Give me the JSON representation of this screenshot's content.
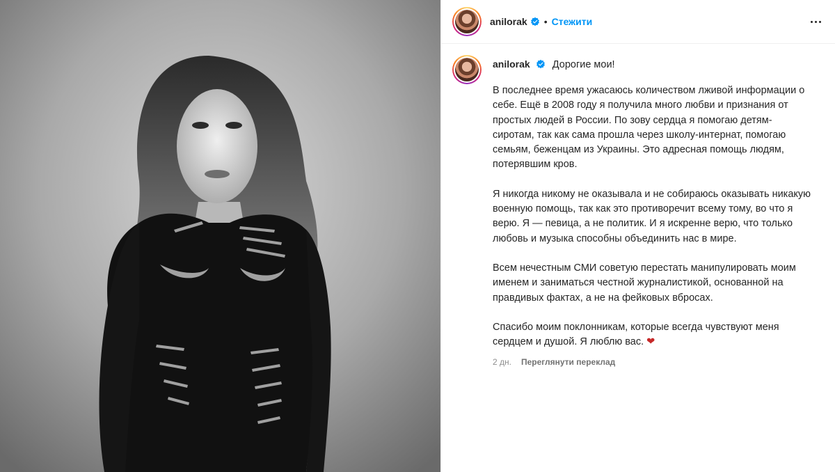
{
  "post": {
    "username": "anilorak",
    "follow_label": "Стежити",
    "separator": "•",
    "greeting": "Дорогие мои!",
    "paragraphs": [
      "В последнее время ужасаюсь количеством лживой информации о себе. Ещё в 2008 году я получила много любви и признания от простых людей в России. По зову сердца я помогаю детям-сиротам, так как сама прошла через школу-интернат, помогаю семьям, беженцам из Украины. Это адресная помощь людям, потерявшим кров.",
      "Я никогда никому не оказывала и не собираюсь оказывать никакую военную помощь, так как это противоречит всему тому, во что я верю. Я — певица, а не политик. И я искренне верю, что только любовь и музыка способны объединить нас в мире.",
      "Всем нечестным СМИ советую перестать манипулировать моим именем и заниматься честной журналистикой, основанной на правдивых фактах, а не на фейковых вбросах."
    ],
    "closing": "Спасибо моим поклонникам, которые всегда чувствуют меня сердцем и душой. Я люблю вас.",
    "heart": "❤",
    "time": "2 дн.",
    "translate_label": "Переглянути переклад",
    "icons": {
      "verified": "verified-badge-icon",
      "more": "more-options-icon",
      "heart": "heart-emoji-icon"
    },
    "colors": {
      "accent": "#0095f6",
      "verified": "#0095f6",
      "heart": "#c62828",
      "meta": "#8e8e8e"
    }
  }
}
